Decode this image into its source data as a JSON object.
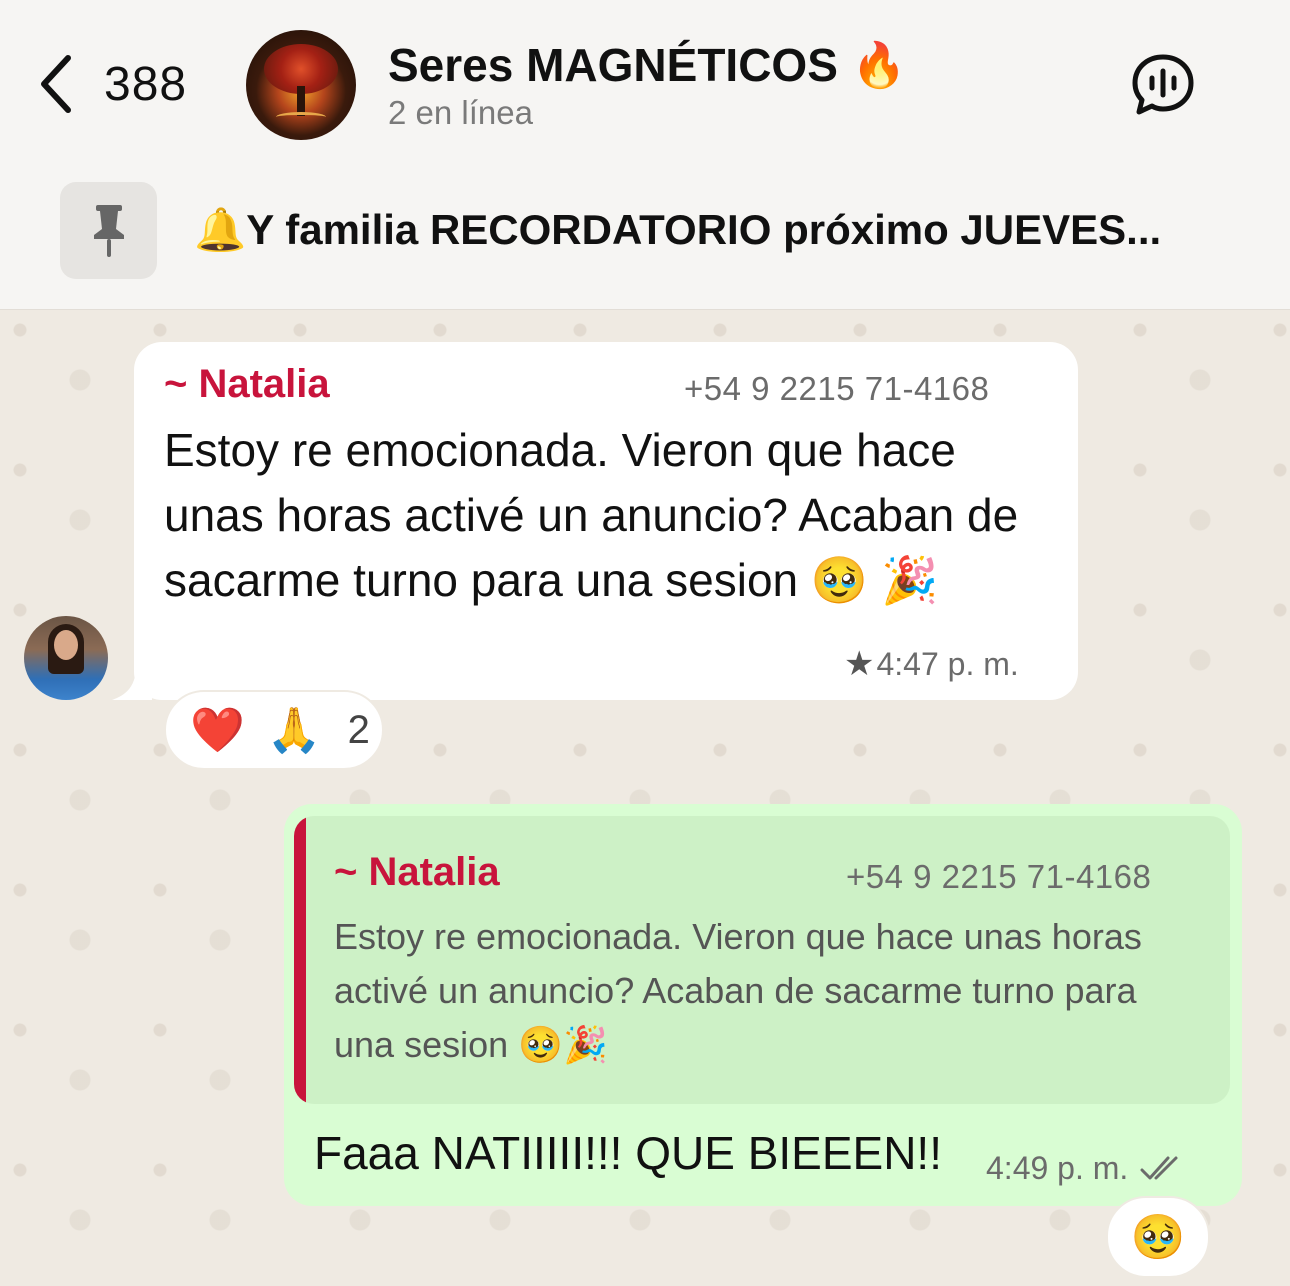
{
  "header": {
    "back_count": "388",
    "group_name": "Seres MAGNÉTICOS",
    "group_emoji": "🔥",
    "status": "2 en línea",
    "voice_icon": "voice-chat-icon"
  },
  "pinned": {
    "icon": "pin-icon",
    "text": "🔔Y familia RECORDATORIO próximo JUEVES..."
  },
  "messages": {
    "incoming": {
      "sender": "~ Natalia",
      "phone": "+54 9 2215 71-4168",
      "text": "Estoy re emocionada. Vieron que hace unas horas activé un anuncio? Acaban de sacarme turno para una sesion 🥹 🎉",
      "time": "4:47 p. m.",
      "starred_icon": "★",
      "reactions": [
        "❤️",
        "🙏"
      ],
      "reaction_count": "2"
    },
    "outgoing": {
      "quoted_sender": "~ Natalia",
      "quoted_phone": "+54 9 2215 71-4168",
      "quoted_text": "Estoy re emocionada. Vieron que hace unas horas activé un anuncio? Acaban de sacarme turno para una sesion 🥹🎉",
      "text": "Faaa NATIIIII!!! QUE BIEEEN!!",
      "time": "4:49 p. m.",
      "status_icon": "double-check-icon",
      "reaction": "🥹"
    }
  },
  "colors": {
    "sender_name": "#c8143c",
    "incoming_bubble": "#ffffff",
    "outgoing_bubble": "#d9fdd3",
    "quote_bg": "#cdf1c6",
    "chat_bg": "#efeae2"
  }
}
